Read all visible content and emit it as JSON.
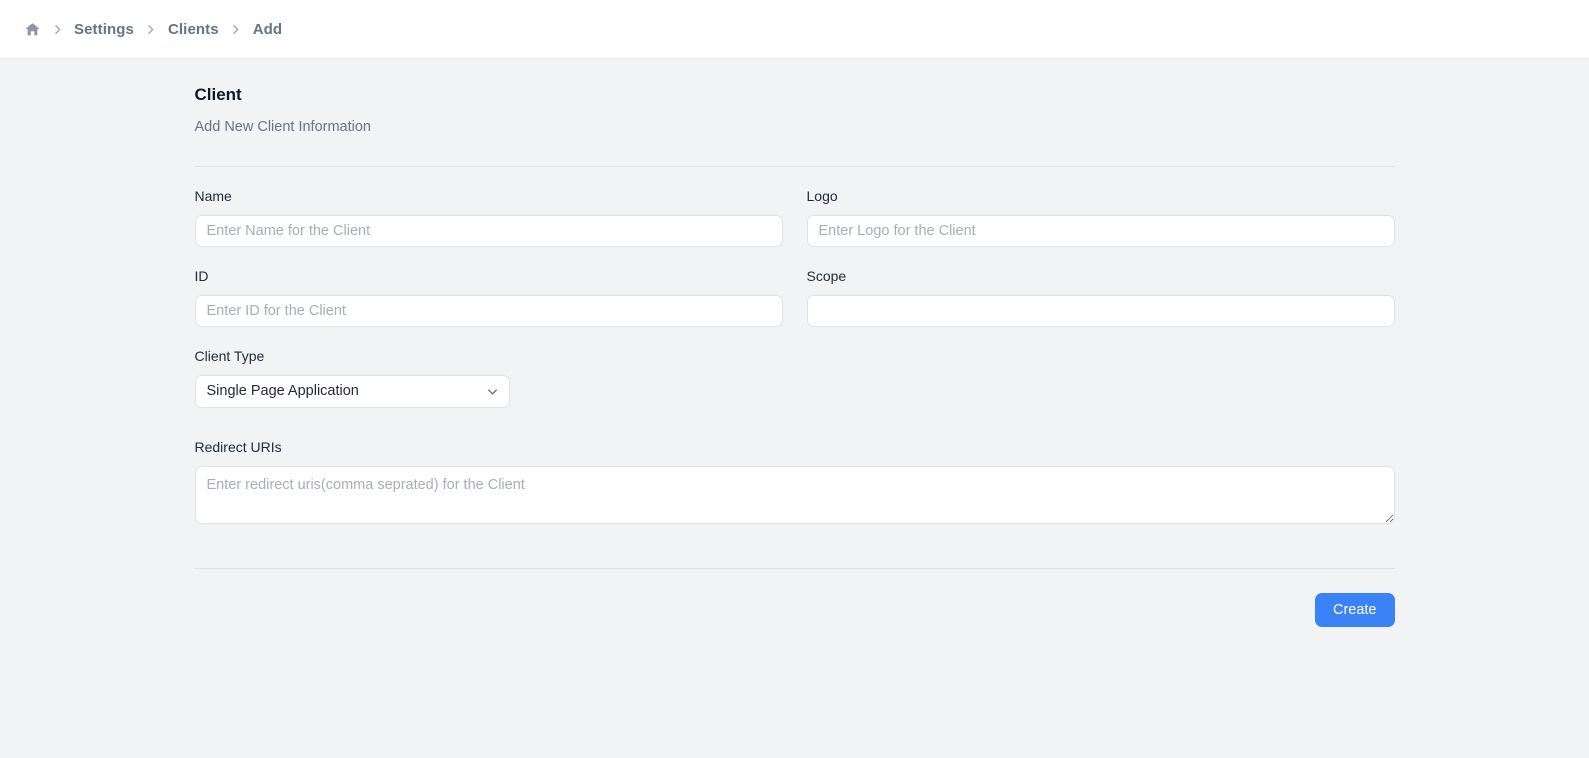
{
  "breadcrumb": {
    "home_icon": "home-icon",
    "separator": "chevron-right-icon",
    "items": [
      {
        "label": "Settings"
      },
      {
        "label": "Clients"
      },
      {
        "label": "Add"
      }
    ]
  },
  "header": {
    "title": "Client",
    "subtitle": "Add New Client Information"
  },
  "form": {
    "name": {
      "label": "Name",
      "placeholder": "Enter Name for the Client",
      "value": ""
    },
    "logo": {
      "label": "Logo",
      "placeholder": "Enter Logo for the Client",
      "value": ""
    },
    "id": {
      "label": "ID",
      "placeholder": "Enter ID for the Client",
      "value": ""
    },
    "scope": {
      "label": "Scope",
      "placeholder": "",
      "value": ""
    },
    "client_type": {
      "label": "Client Type",
      "selected": "Single Page Application",
      "chevron_icon": "chevron-down-icon",
      "options": [
        "Single Page Application"
      ]
    },
    "redirect_uris": {
      "label": "Redirect URIs",
      "placeholder": "Enter redirect uris(comma seprated) for the Client",
      "value": ""
    }
  },
  "actions": {
    "create_label": "Create"
  },
  "colors": {
    "accent": "#3b82f6",
    "page_background": "#f1f3f5",
    "topbar_background": "#ffffff",
    "field_border": "#dfe2e6",
    "breadcrumb_text": "#64748b",
    "title_text": "#111827",
    "subtitle_text": "#6b7280",
    "placeholder_text": "#a7aeb8",
    "divider": "#dcdfe3"
  }
}
